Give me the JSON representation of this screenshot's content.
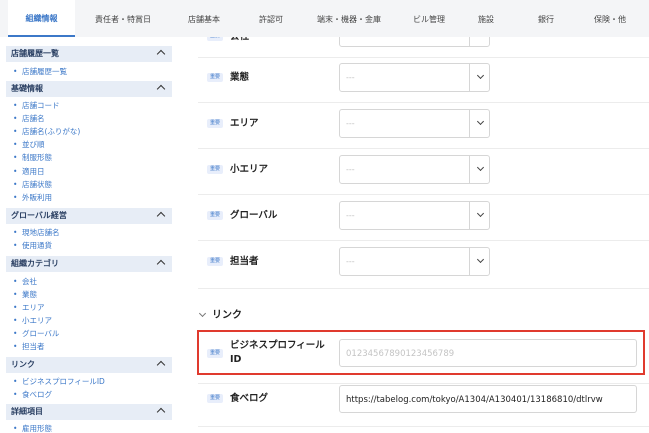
{
  "tabs": [
    {
      "label": "組織情報",
      "active": true
    },
    {
      "label": "責任者・特賞日",
      "active": false
    },
    {
      "label": "店舗基本",
      "active": false
    },
    {
      "label": "許認可",
      "active": false
    },
    {
      "label": "端末・機器・金庫",
      "active": false
    },
    {
      "label": "ビル管理",
      "active": false
    },
    {
      "label": "施設",
      "active": false
    },
    {
      "label": "銀行",
      "active": false
    },
    {
      "label": "保険・他",
      "active": false
    }
  ],
  "sidebar": {
    "sections": [
      {
        "title": "店舗履歴一覧",
        "items": [
          "店舗履歴一覧"
        ]
      },
      {
        "title": "基礎情報",
        "items": [
          "店舗コード",
          "店舗名",
          "店舗名(ふりがな)",
          "並び順",
          "制服形態",
          "適用日",
          "店舗状態",
          "外販利用"
        ]
      },
      {
        "title": "グローバル経営",
        "items": [
          "現地店舗名",
          "使用通貨"
        ]
      },
      {
        "title": "組織カテゴリ",
        "items": [
          "会社",
          "業態",
          "エリア",
          "小エリア",
          "グローバル",
          "担当者"
        ]
      },
      {
        "title": "リンク",
        "items": [
          "ビジネスプロフィールID",
          "食べログ"
        ]
      },
      {
        "title": "詳細項目",
        "items": [
          "雇用形態"
        ]
      }
    ]
  },
  "form": {
    "badge_text": "重要",
    "top_partial_label": "会社",
    "fields": [
      {
        "label": "業態",
        "value": "---"
      },
      {
        "label": "エリア",
        "value": "---"
      },
      {
        "label": "小エリア",
        "value": "---"
      },
      {
        "label": "グローバル",
        "value": "---"
      },
      {
        "label": "担当者",
        "value": "---"
      }
    ],
    "link_section": {
      "title": "リンク",
      "business_profile": {
        "label_line1": "ビジネスプロフィール",
        "label_line2": "ID",
        "placeholder": "01234567890123456789"
      },
      "tabelog": {
        "label": "食べログ",
        "value": "https://tabelog.com/tokyo/A1304/A130401/13186810/dtlrvw"
      }
    }
  },
  "colors": {
    "accent": "#3c78c8",
    "highlight": "#e03a2e",
    "sidebar_header_bg": "#e7edf6",
    "tabbar_bg": "#f4f5f7"
  }
}
